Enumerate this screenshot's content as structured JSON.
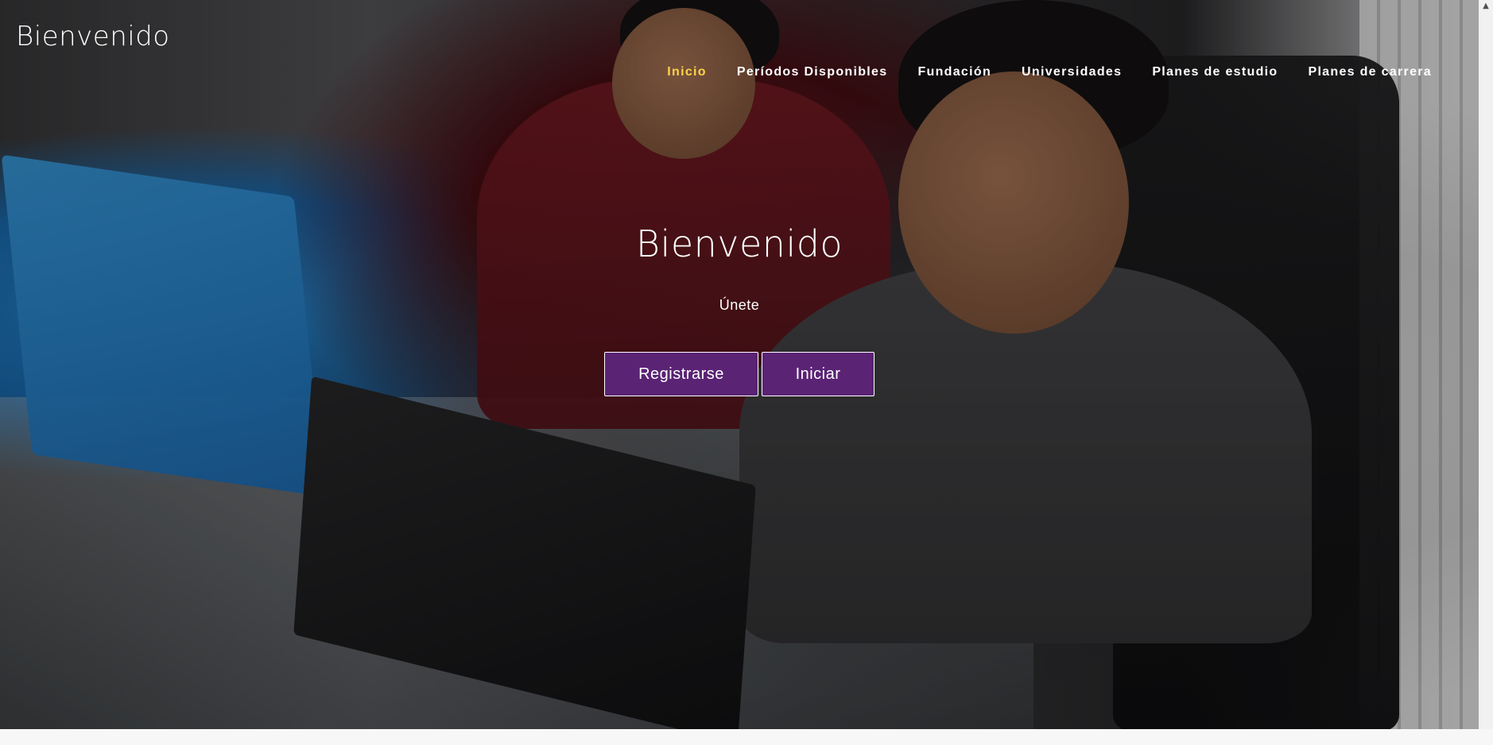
{
  "header": {
    "brand": "Bienvenido"
  },
  "nav": {
    "items": [
      {
        "label": "Inicio",
        "active": true
      },
      {
        "label": "Períodos Disponibles",
        "active": false
      },
      {
        "label": "Fundación",
        "active": false
      },
      {
        "label": "Universidades",
        "active": false
      },
      {
        "label": "Planes de estudio",
        "active": false
      },
      {
        "label": "Planes de carrera",
        "active": false
      }
    ]
  },
  "hero": {
    "title": "Bienvenido",
    "subtitle": "Únete",
    "register_label": "Registrarse",
    "login_label": "Iniciar"
  },
  "colors": {
    "active_nav": "#ffd24a",
    "button_bg": "#5a2374",
    "text": "#ffffff"
  },
  "icons": {
    "scroll_up": "chevron-up-icon",
    "hero_image": "students-with-laptops-photo"
  }
}
